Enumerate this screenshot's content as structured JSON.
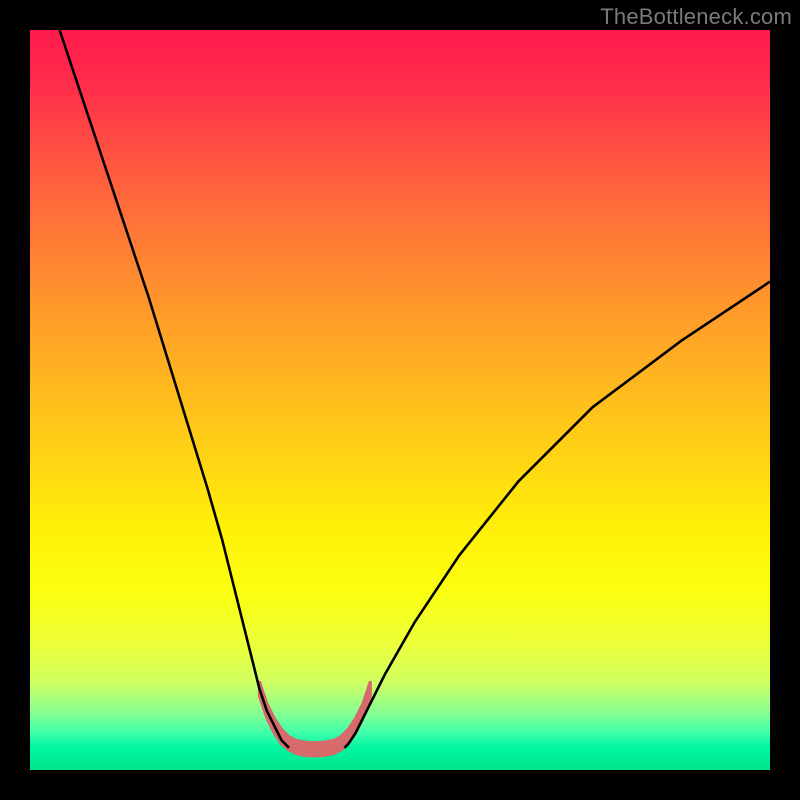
{
  "watermark": "TheBottleneck.com",
  "chart_data": {
    "type": "line",
    "title": "",
    "xlabel": "",
    "ylabel": "",
    "xlim": [
      0,
      100
    ],
    "ylim": [
      0,
      100
    ],
    "grid": false,
    "legend": false,
    "series": [
      {
        "name": "left-curve",
        "x": [
          4,
          8,
          12,
          16,
          20,
          24,
          26,
          28,
          30,
          31,
          32,
          33,
          33.5,
          34,
          34.5,
          35
        ],
        "values": [
          100,
          88,
          76,
          64,
          51,
          38,
          31,
          23,
          15,
          11,
          8,
          6,
          5,
          4,
          3.5,
          3
        ]
      },
      {
        "name": "right-curve",
        "x": [
          42.5,
          43,
          44,
          45,
          46,
          48,
          52,
          58,
          66,
          76,
          88,
          100
        ],
        "values": [
          3,
          3.5,
          5,
          7,
          9,
          13,
          20,
          29,
          39,
          49,
          58,
          66
        ]
      },
      {
        "name": "valley-band-upper",
        "x": [
          31,
          32,
          33,
          34,
          35,
          36,
          37,
          38,
          39,
          40,
          41,
          42,
          43,
          44,
          45,
          46
        ],
        "values": [
          12,
          9,
          7,
          5.5,
          4.5,
          4,
          3.8,
          3.7,
          3.7,
          3.8,
          4,
          4.5,
          5.5,
          7,
          9,
          12
        ]
      },
      {
        "name": "valley-band-lower",
        "x": [
          31,
          32,
          33,
          34,
          35,
          36,
          37,
          38,
          39,
          40,
          41,
          42,
          43,
          44,
          45,
          46
        ],
        "values": [
          10,
          7,
          5,
          3.5,
          2.7,
          2.2,
          2,
          1.9,
          1.9,
          2,
          2.2,
          2.7,
          3.5,
          5,
          7,
          10
        ]
      }
    ],
    "annotations": []
  },
  "colors": {
    "background_frame": "#000000",
    "curve": "#000000",
    "valley_band": "#d76a6a"
  }
}
